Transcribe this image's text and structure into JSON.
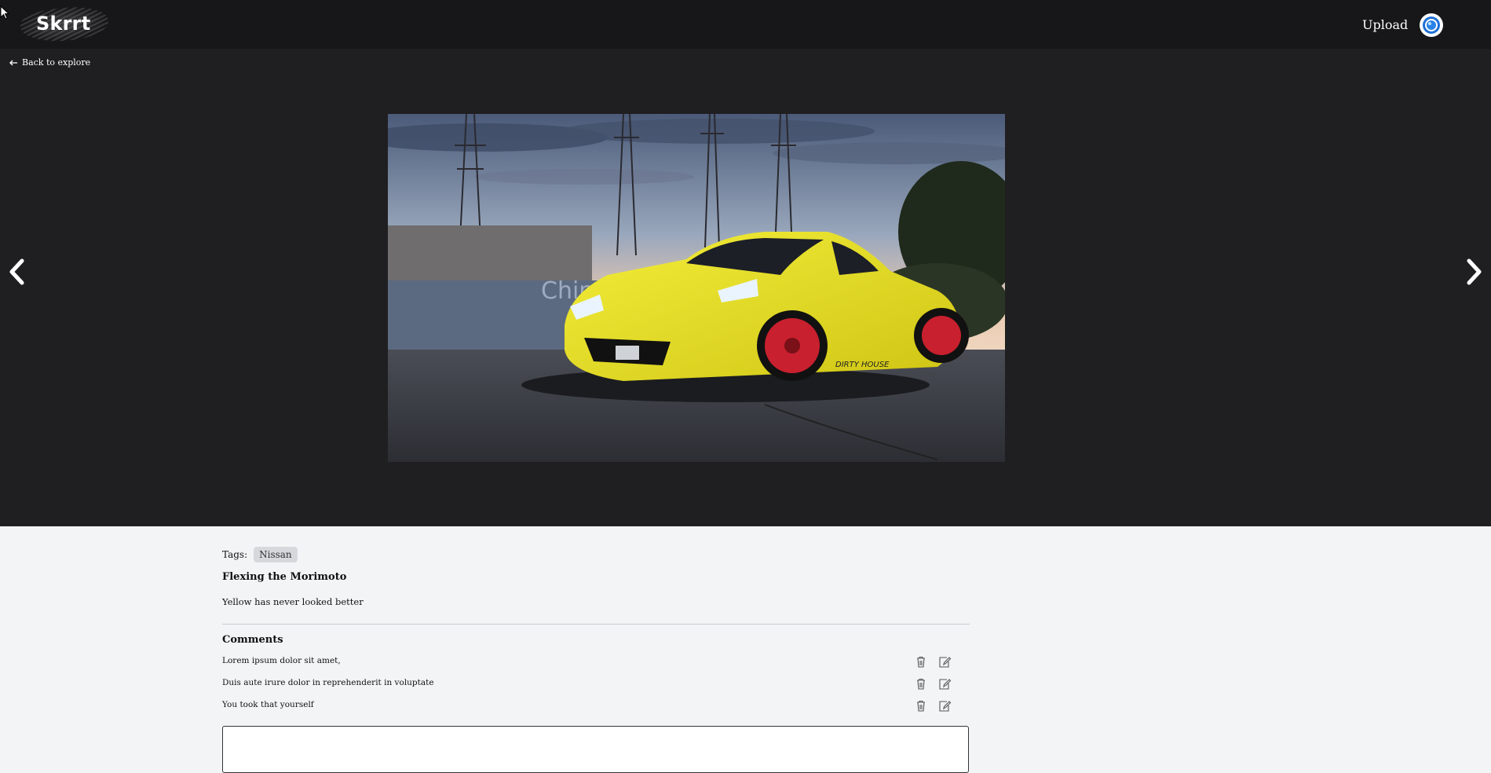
{
  "header": {
    "logo_text": "Skrrt",
    "upload_label": "Upload",
    "avatar_icon": "camera-lens-icon"
  },
  "viewer": {
    "back_label": "Back to explore",
    "photo_alt": "Yellow sports car with red wheels",
    "prev_icon": "chevron-left-icon",
    "next_icon": "chevron-right-icon"
  },
  "post": {
    "tags_label": "Tags:",
    "tags": [
      "Nissan"
    ],
    "title": "Flexing the Morimoto",
    "description": "Yellow has never looked better"
  },
  "comments": {
    "heading": "Comments",
    "items": [
      {
        "text": "Lorem ipsum dolor sit amet,"
      },
      {
        "text": "Duis aute irure dolor in reprehenderit in voluptate"
      },
      {
        "text": "You took that yourself"
      }
    ],
    "delete_icon": "trash-icon",
    "edit_icon": "edit-icon",
    "input_value": ""
  },
  "colors": {
    "header_bg": "#17171a",
    "viewer_bg": "#1f1f21",
    "page_bg": "#f3f4f6",
    "tag_bg": "#d6d8dc",
    "car_yellow": "#e8e01e",
    "wheel_red": "#c8202e"
  }
}
